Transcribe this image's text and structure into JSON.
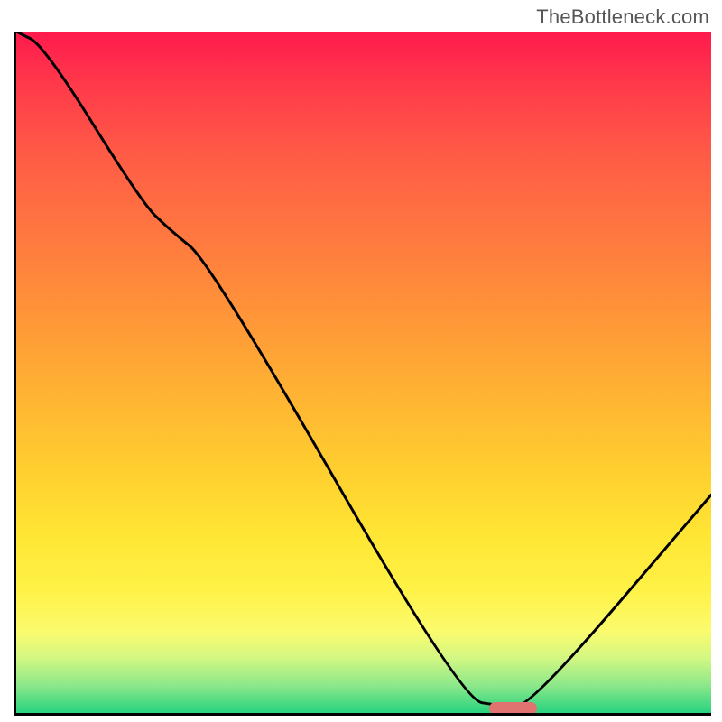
{
  "watermark": "TheBottleneck.com",
  "chart_data": {
    "type": "line",
    "title": "",
    "xlabel": "",
    "ylabel": "",
    "xlim": [
      0,
      100
    ],
    "ylim": [
      0,
      100
    ],
    "grid": false,
    "background_gradient": {
      "top_color": "#ff1a4d",
      "bottom_color": "#27d27f",
      "description": "vertical red-to-green gradient"
    },
    "series": [
      {
        "name": "bottleneck-curve",
        "x": [
          0,
          4,
          18,
          22,
          28,
          64,
          70,
          74,
          100
        ],
        "values": [
          100,
          98,
          75,
          71,
          66,
          2,
          1,
          1,
          32
        ],
        "stroke": "#000000"
      }
    ],
    "annotations": [
      {
        "name": "optimal-marker",
        "type": "segment",
        "x_start": 68,
        "x_end": 75,
        "y": 0.7,
        "color": "#e0726f"
      }
    ]
  }
}
